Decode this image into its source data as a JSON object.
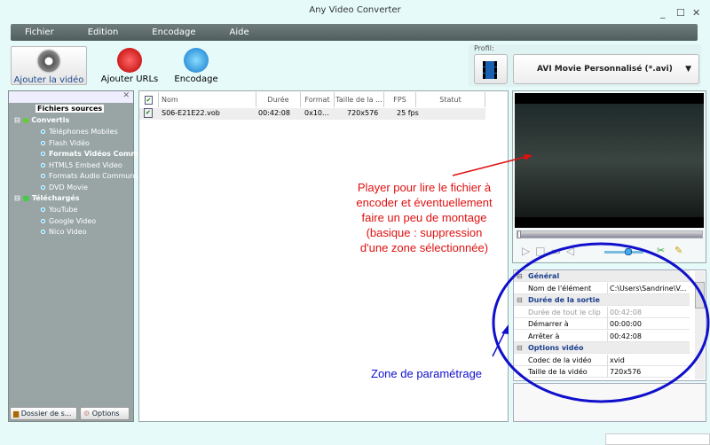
{
  "window": {
    "title": "Any Video Converter"
  },
  "menu": [
    "Fichier",
    "Edition",
    "Encodage",
    "Aide"
  ],
  "toolbar": {
    "add_video": "Ajouter la vidéo",
    "add_urls": "Ajouter URLs",
    "encode": "Encodage"
  },
  "profile": {
    "label": "Profil:",
    "value": "AVI Movie Personnalisé (*.avi)"
  },
  "tree": {
    "sources": "Fichiers sources",
    "converted": "Convertis",
    "converted_items": [
      "Téléphones Mobiles",
      "Flash Vidéo",
      "Formats Vidéos Communs",
      "HTML5 Embed Video",
      "Formats Audio Communs",
      "DVD Movie"
    ],
    "downloaded": "Téléchargés",
    "downloaded_items": [
      "YouTube",
      "Google Video",
      "Nico Video"
    ]
  },
  "left_buttons": {
    "folder": "Dossier de s...",
    "options": "Options"
  },
  "table": {
    "headers": [
      "Nom",
      "Durée",
      "Format",
      "Taille de la ...",
      "FPS",
      "Statut"
    ],
    "rows": [
      {
        "checked": true,
        "cells": [
          "S06-E21E22.vob",
          "00:42:08",
          "0x10...",
          "720x576",
          "25 fps",
          ""
        ]
      }
    ]
  },
  "player": {
    "seek_fraction": 0.0,
    "volume_fraction": 0.6
  },
  "properties": [
    {
      "section": "Général"
    },
    {
      "key": "Nom de l'élément",
      "value": "C:\\Users\\Sandrine\\V..."
    },
    {
      "section": "Durée de la sortie"
    },
    {
      "key": "Durée de tout le clip",
      "value": "00:42:08",
      "disabled": true
    },
    {
      "key": "Démarrer à",
      "value": "00:00:00"
    },
    {
      "key": "Arrêter à",
      "value": "00:42:08"
    },
    {
      "section": "Options vidéo"
    },
    {
      "key": "Codec de la vidéo",
      "value": "xvid"
    },
    {
      "key": "Taille de la vidéo",
      "value": "720x576"
    }
  ],
  "annotations": {
    "player_note": [
      "Player pour lire le fichier à",
      "encoder et éventuellement",
      "faire un peu de montage",
      "(basique : suppression",
      "d'une zone sélectionnée)"
    ],
    "settings_note": "Zone de paramétrage",
    "colors": {
      "red": "#e01010",
      "blue": "#1010cc"
    }
  }
}
